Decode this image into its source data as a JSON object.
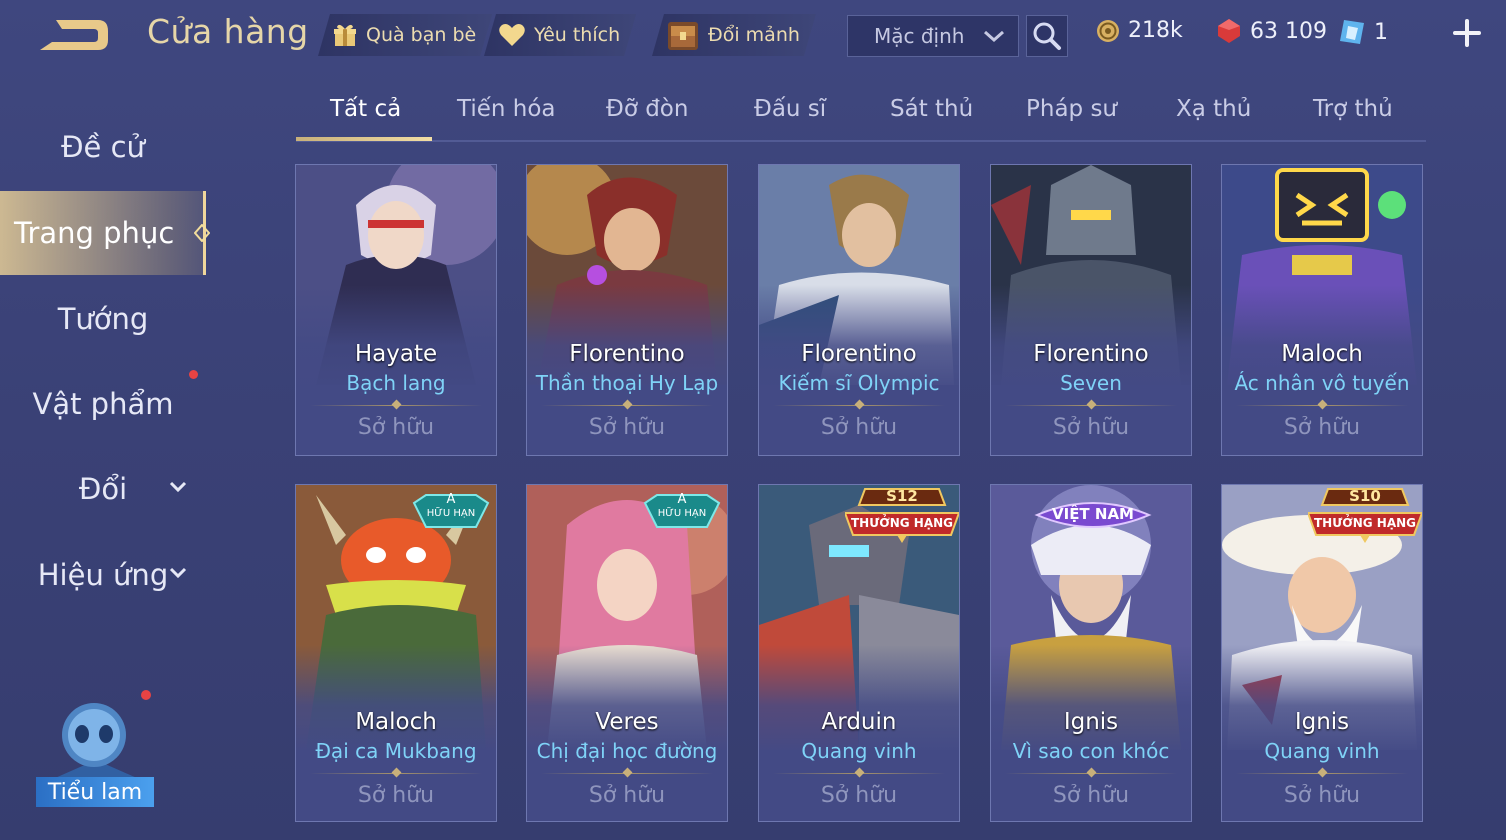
{
  "header": {
    "title": "Cửa hàng",
    "buttons": {
      "gift": "Quà bạn bè",
      "favorite": "Yêu thích",
      "exchange": "Đổi mảnh"
    },
    "sort": {
      "selected": "Mặc định"
    },
    "currency": {
      "gold": "218k",
      "vouchers": "63 109",
      "tokens": "1"
    }
  },
  "sidebar": {
    "items": [
      {
        "label": "Đề cử"
      },
      {
        "label": "Trang phục"
      },
      {
        "label": "Tướng"
      },
      {
        "label": "Vật phẩm"
      },
      {
        "label": "Đổi"
      },
      {
        "label": "Hiệu ứng"
      }
    ],
    "tieulam": "Tiểu lam"
  },
  "tabs": [
    "Tất cả",
    "Tiến hóa",
    "Đỡ đòn",
    "Đấu sĩ",
    "Sát thủ",
    "Pháp sư",
    "Xạ thủ",
    "Trợ thủ"
  ],
  "cards": [
    {
      "hero": "Hayate",
      "skin": "Bạch lang",
      "status": "Sở hữu"
    },
    {
      "hero": "Florentino",
      "skin": "Thần thoại Hy Lạp",
      "status": "Sở hữu"
    },
    {
      "hero": "Florentino",
      "skin": "Kiếm sĩ Olympic",
      "status": "Sở hữu"
    },
    {
      "hero": "Florentino",
      "skin": "Seven",
      "status": "Sở hữu"
    },
    {
      "hero": "Maloch",
      "skin": "Ác nhân vô tuyến",
      "status": "Sở hữu"
    },
    {
      "hero": "Maloch",
      "skin": "Đại ca Mukbang",
      "status": "Sở hữu",
      "badge": {
        "top": "A",
        "bottom": "HỮU HẠN"
      }
    },
    {
      "hero": "Veres",
      "skin": "Chị đại học đường",
      "status": "Sở hữu",
      "badge": {
        "top": "A",
        "bottom": "HỮU HẠN"
      }
    },
    {
      "hero": "Arduin",
      "skin": "Quang vinh",
      "status": "Sở hữu",
      "badge": {
        "top": "S12",
        "bottom": "THƯỞNG HẠNG"
      }
    },
    {
      "hero": "Ignis",
      "skin": "Vì sao con khóc",
      "status": "Sở hữu",
      "badge": {
        "top": "VIỆT NAM"
      }
    },
    {
      "hero": "Ignis",
      "skin": "Quang vinh",
      "status": "Sở hữu",
      "badge": {
        "top": "S10",
        "bottom": "THƯỞNG HẠNG"
      }
    }
  ],
  "colors": {
    "accent_gold": "#e6d6a8",
    "skin_name": "#7fd3f7",
    "notification": "#e74343"
  }
}
